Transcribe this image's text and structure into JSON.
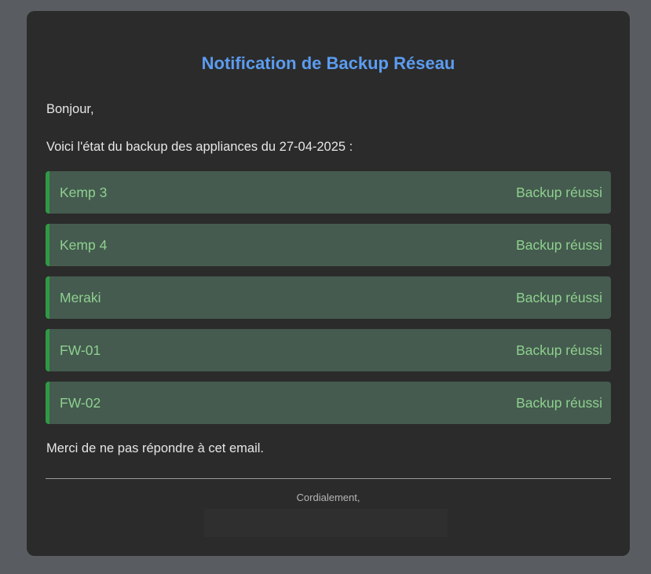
{
  "email": {
    "title": "Notification de Backup Réseau",
    "greeting": "Bonjour,",
    "intro": "Voici l'état du backup des appliances du 27-04-2025 :",
    "appliances": [
      {
        "name": "Kemp 3",
        "status": "Backup réussi"
      },
      {
        "name": "Kemp 4",
        "status": "Backup réussi"
      },
      {
        "name": "Meraki",
        "status": "Backup réussi"
      },
      {
        "name": "FW-01",
        "status": "Backup réussi"
      },
      {
        "name": "FW-02",
        "status": "Backup réussi"
      }
    ],
    "outro": "Merci de ne pas répondre à cet email.",
    "signoff": "Cordialement,"
  },
  "colors": {
    "page_background": "#595c60",
    "card_background": "#2b2b2b",
    "title_accent": "#5b9cf0",
    "success_background": "#455b4f",
    "success_border": "#2e9a44",
    "success_text": "#8ed08f"
  }
}
